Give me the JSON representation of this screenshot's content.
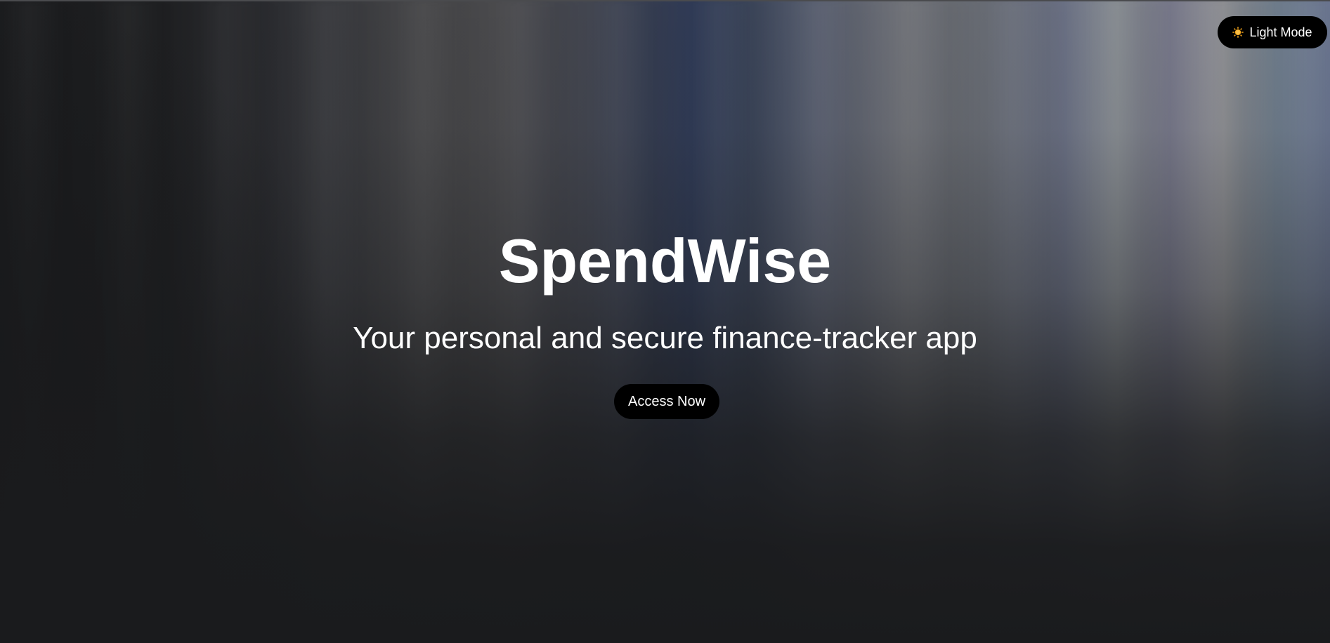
{
  "header": {
    "mode_toggle": {
      "label": "Light Mode",
      "icon": "sun-icon",
      "icon_color": "#f4a51c"
    }
  },
  "hero": {
    "title": "SpendWise",
    "subtitle": "Your personal and secure finance-tracker app",
    "cta_label": "Access Now"
  },
  "colors": {
    "button_bg": "#000000",
    "text": "#ffffff",
    "page_bg": "#1a1b1d"
  }
}
